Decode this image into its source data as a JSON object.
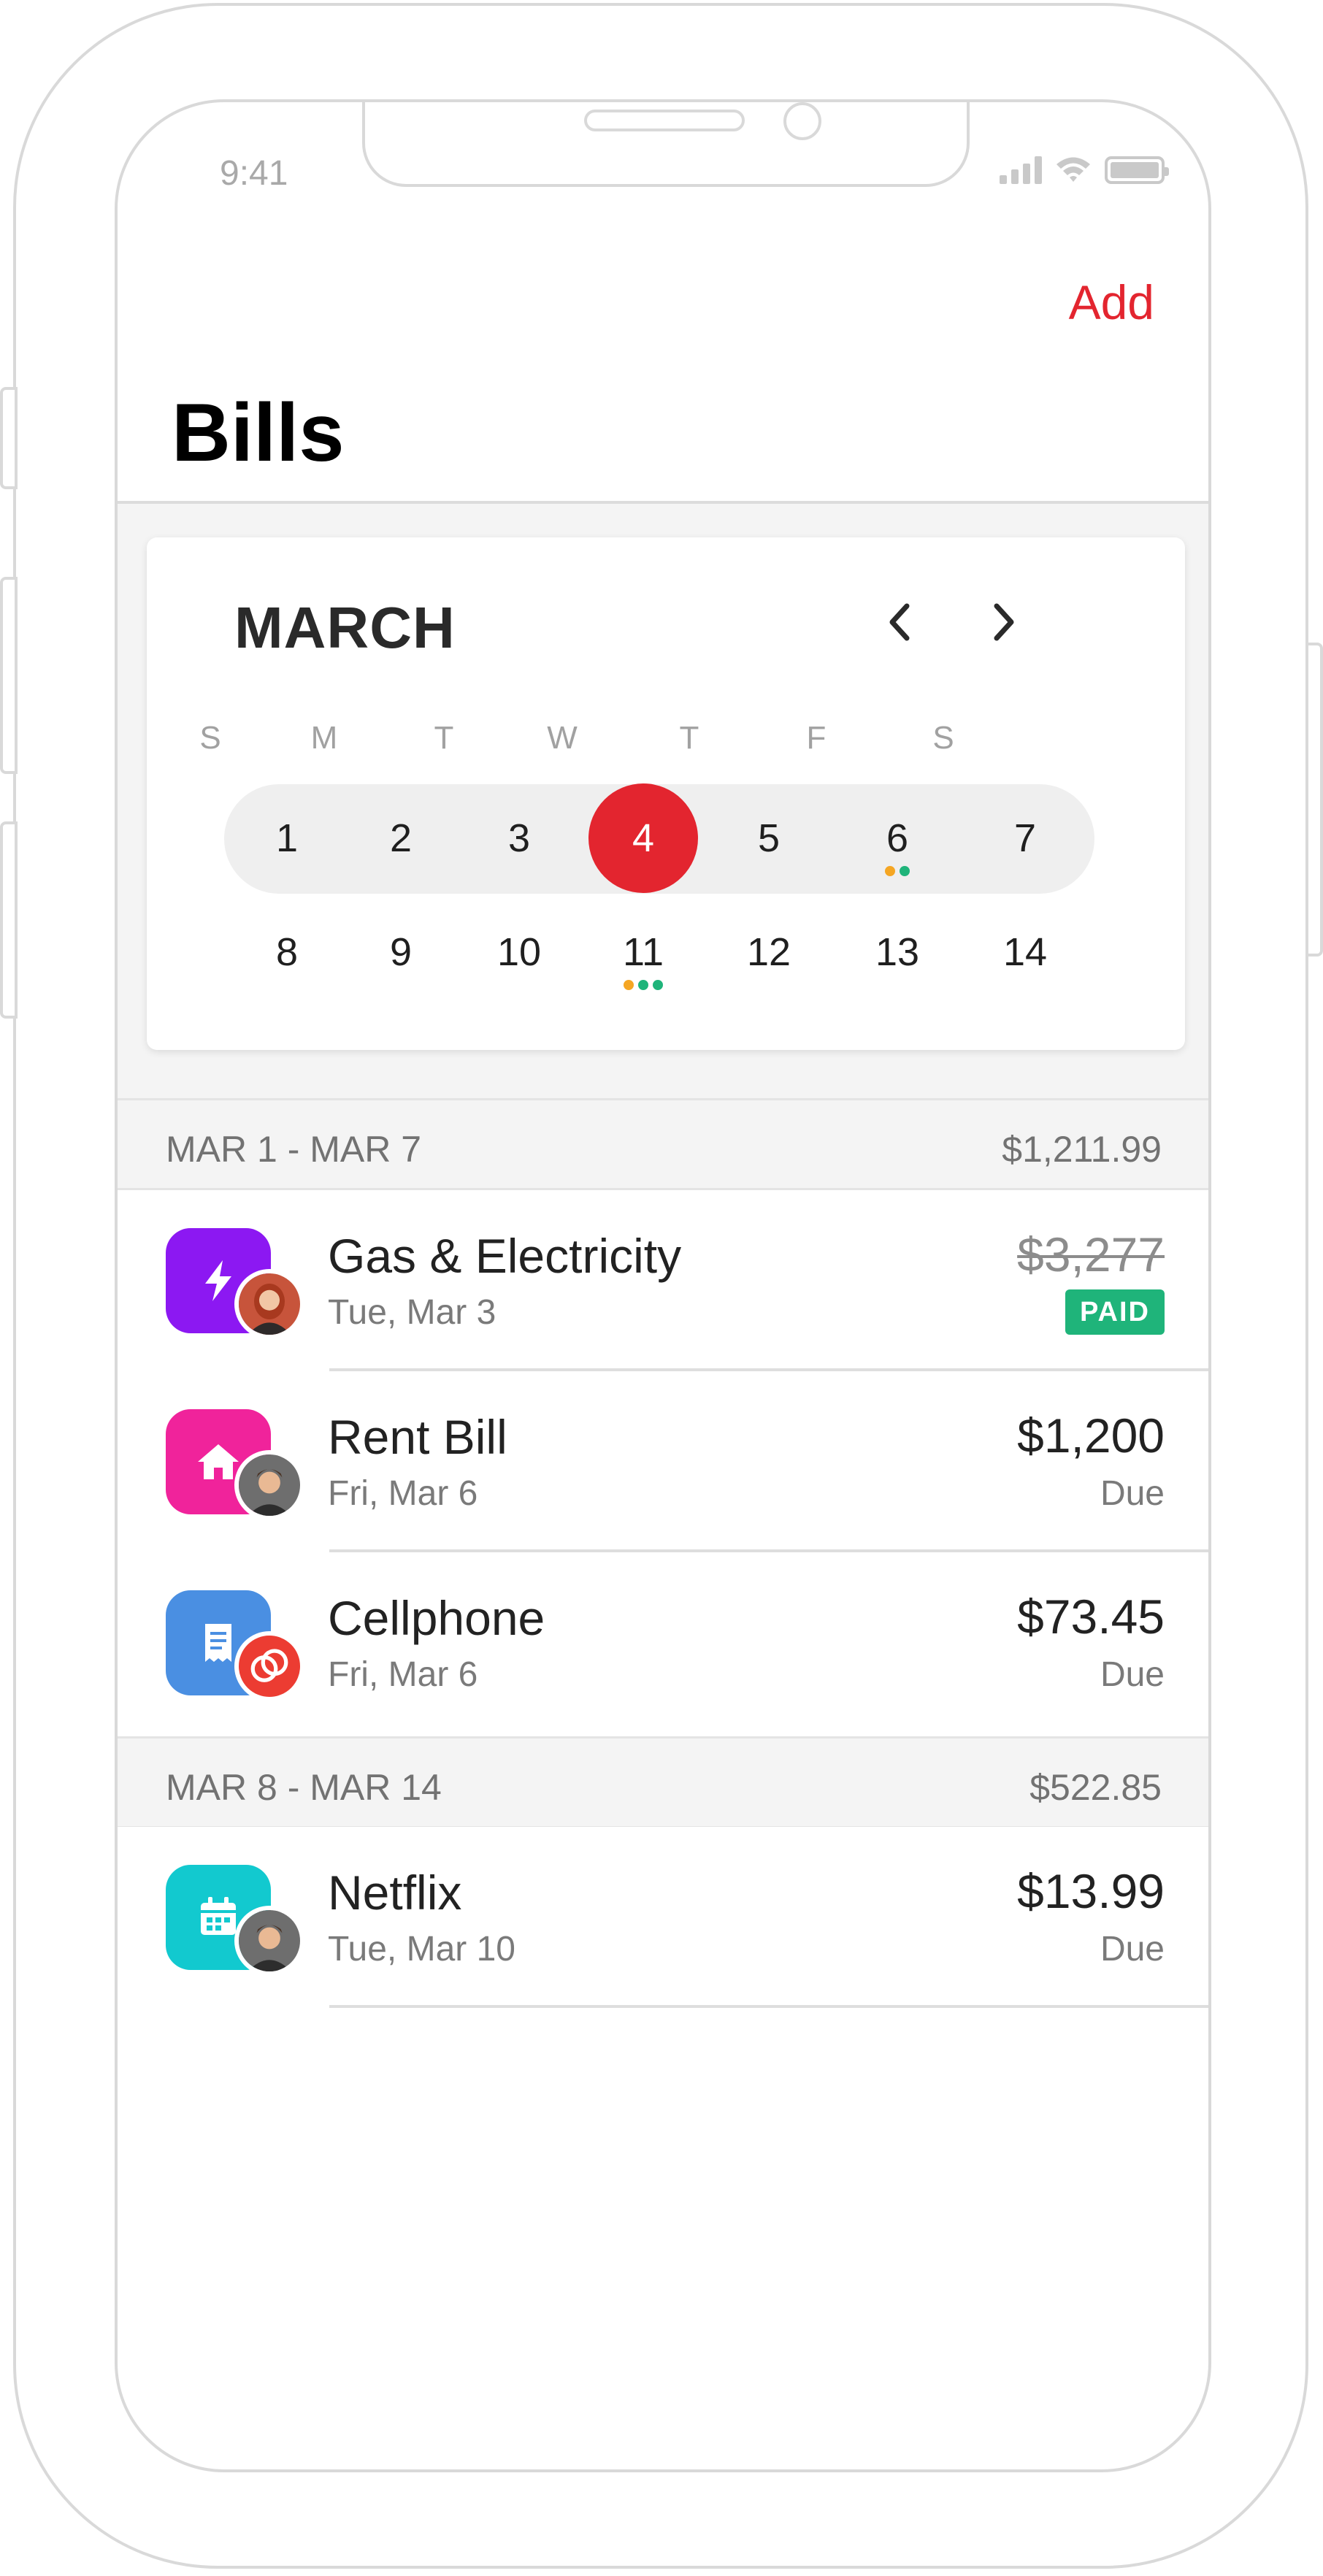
{
  "status_bar": {
    "time": "9:41"
  },
  "header": {
    "add_label": "Add",
    "title": "Bills"
  },
  "calendar": {
    "month": "MARCH",
    "weekdays": [
      "S",
      "M",
      "T",
      "W",
      "T",
      "F",
      "S"
    ],
    "weeks": [
      [
        "1",
        "2",
        "3",
        "4",
        "5",
        "6",
        "7"
      ],
      [
        "8",
        "9",
        "10",
        "11",
        "12",
        "13",
        "14"
      ]
    ],
    "selected_day": "4"
  },
  "colors": {
    "accent": "#e3252f",
    "paid": "#1fb47a",
    "dot_orange": "#f5a623",
    "dot_green": "#1fb47a"
  },
  "sections": [
    {
      "range": "MAR 1 - MAR 7",
      "total": "$1,211.99",
      "bills": [
        {
          "title": "Gas & Electricity",
          "date": "Tue, Mar 3",
          "amount": "$3,277",
          "status": "PAID",
          "icon": "lightning-icon",
          "tile_color": "#8c18f2"
        },
        {
          "title": "Rent Bill",
          "date": "Fri, Mar 6",
          "amount": "$1,200",
          "status": "Due",
          "icon": "home-icon",
          "tile_color": "#f0239b"
        },
        {
          "title": "Cellphone",
          "date": "Fri, Mar 6",
          "amount": "$73.45",
          "status": "Due",
          "icon": "receipt-icon",
          "tile_color": "#4a8fe2"
        }
      ]
    },
    {
      "range": "MAR 8 - MAR 14",
      "total": "$522.85",
      "bills": [
        {
          "title": "Netflix",
          "date": "Tue, Mar 10",
          "amount": "$13.99",
          "status": "Due",
          "icon": "calendar-icon",
          "tile_color": "#12c9cf"
        }
      ]
    }
  ]
}
